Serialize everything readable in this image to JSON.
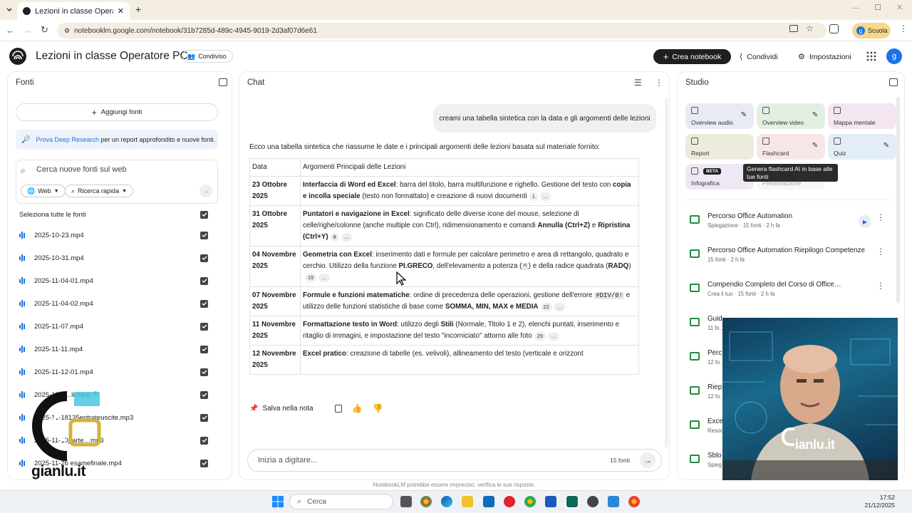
{
  "browser": {
    "tab_title": "Lezioni in classe Operatore PC",
    "url": "notebooklm.google.com/notebook/31b7285d-489c-4945-9019-2d3af07d6e61",
    "profile_label": "Scuola",
    "profile_initial": "g"
  },
  "app": {
    "notebook_title": "Lezioni in classe Operatore PC",
    "shared_label": "Condiviso",
    "new_notebook": "Crea notebook",
    "share": "Condividi",
    "settings": "Impostazioni",
    "avatar_initial": "g"
  },
  "sources": {
    "header": "Fonti",
    "add_sources": "Aggiungi fonti",
    "deep_research_link": "Prova Deep Research",
    "deep_research_text": " per un report approfondito e nuove fonti.",
    "search_placeholder": "Cerca nuove fonti sul web",
    "web_chip": "Web",
    "fast_search_chip": "Ricerca rapida",
    "select_all": "Seleziona tutte le fonti",
    "items": [
      "2025-10-23.mp4",
      "2025-10-31.mp4",
      "2025-11-04-01.mp4",
      "2025-11-04-02.mp4",
      "2025-11-07.mp4",
      "2025-11-11.mp4",
      "2025-11-12-01.mp4",
      "2025-11-1…li.mp4",
      "2025-11-18135entrateuscite.mp3",
      "2025-11-19parte…mp3",
      "2025-11-26 esamefinale.mp4"
    ]
  },
  "chat": {
    "header": "Chat",
    "user_message": "creami una tabella sintetica con la data e gli argomenti delle lezioni",
    "intro": "Ecco una tabella sintetica che riassume le date e i principali argomenti delle lezioni basata sul materiale fornito:",
    "table_headers": [
      "Data",
      "Argomenti Principali delle Lezioni"
    ],
    "rows": [
      {
        "date": "23 Ottobre 2025",
        "title": "Interfaccia di Word ed Excel",
        "text_a": ": barra del titolo, barra multifunzione e righello. Gestione del testo con ",
        "bold_b": "copia e incolla speciale",
        "text_c": " (testo non formattato) e creazione di nuovi documenti",
        "cite": "1"
      },
      {
        "date": "31 Ottobre 2025",
        "title": "Puntatori e navigazione in Excel",
        "text_a": ": significato delle diverse icone del mouse, selezione di celle/righe/colonne (anche multiple con Ctrl), ridimensionamento e comandi ",
        "bold_b": "Annulla (Ctrl+Z)",
        "text_c": " e ",
        "bold_d": "Ripristina (Ctrl+Y)",
        "cite": "8"
      },
      {
        "date": "04 Novembre 2025",
        "title": "Geometria con Excel",
        "text_a": ": inserimento dati e formule per calcolare perimetro e area di rettangolo, quadrato e cerchio. Utilizzo della funzione ",
        "bold_b": "PI.GRECO",
        "text_c": ", dell'elevamento a potenza (",
        "code": "^",
        "text_d": ") e della radice quadrata (",
        "bold_e": "RADQ",
        "text_f": ")",
        "cite": "15"
      },
      {
        "date": "07 Novembre 2025",
        "title": "Formule e funzioni matematiche",
        "text_a": ": ordine di precedenza delle operazioni, gestione dell'errore ",
        "code": "#DIV/0!",
        "text_c": " e utilizzo delle funzioni statistiche di base come ",
        "bold_b": "SOMMA, MIN, MAX e MEDIA",
        "cite": "22"
      },
      {
        "date": "11 Novembre 2025",
        "title": "Formattazione testo in Word",
        "text_a": ": utilizzo degli ",
        "bold_b": "Stili",
        "text_c": " (Normale, Titolo 1 e 2), elenchi puntati, inserimento e ritaglio di immagini, e impostazione del testo \"incorniciato\" attorno alle foto",
        "cite": "29"
      },
      {
        "date": "12 Novembre 2025",
        "title": "Excel pratico",
        "text_a": ": creazione di tabelle (es. velivoli), allineamento del testo (verticale e orizzont"
      }
    ],
    "ellipsis": "…",
    "save_note": "Salva nella nota",
    "input_placeholder": "Inizia a digitare...",
    "source_count": "15 fonti",
    "disclaimer": "NotebookLM potrebbe essere impreciso; verifica le sue risposte."
  },
  "studio": {
    "header": "Studio",
    "tiles": [
      {
        "label": "Overview audio",
        "color": "#e8eaf4"
      },
      {
        "label": "Overview video",
        "color": "#e4efe4"
      },
      {
        "label": "Mappa mentale",
        "color": "#f3e6f0"
      },
      {
        "label": "Report",
        "color": "#ecebdc"
      },
      {
        "label": "Flashcard",
        "color": "#f6e7e6"
      },
      {
        "label": "Quiz",
        "color": "#e3edf6"
      },
      {
        "label": "Infografica",
        "color": "#efe7f4"
      },
      {
        "label": "Presentazione",
        "color": "#edeee9"
      }
    ],
    "beta": "BETA",
    "tooltip": "Genera flashcard AI in base alle tue fonti",
    "notes": [
      {
        "title": "Percorso Office Automation",
        "sub": "Spiegazione · 15 fonti · 2 h fa"
      },
      {
        "title": "Percorso Office Automation Riepilogo Competenze",
        "sub": "15 fonti · 2 h fa"
      },
      {
        "title": "Compendio Completo del Corso di Office…",
        "sub": "Crea il tuo · 15 fonti · 2 h fa"
      },
      {
        "title": "Guid…",
        "sub": "11 fo…"
      },
      {
        "title": "Perc…",
        "sub": "12 fo…"
      },
      {
        "title": "Riep…",
        "sub": "12 fo…"
      },
      {
        "title": "Exce…",
        "sub": "Resoc…"
      },
      {
        "title": "Sblo…",
        "sub": "Spieg…"
      }
    ],
    "video_watermark": "ianlu.it"
  },
  "watermark": {
    "text": "gianlu.it"
  },
  "taskbar": {
    "search": "Cerca",
    "time": "17:52",
    "date": "21/12/2025"
  }
}
